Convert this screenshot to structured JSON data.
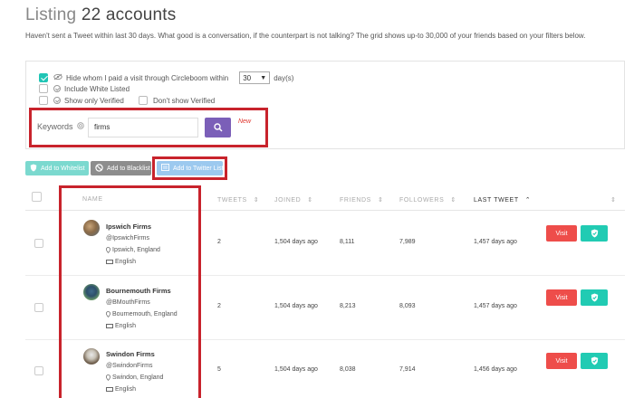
{
  "header": {
    "title_prefix": "Listing",
    "title_count": "22 accounts",
    "subtitle": "Haven't sent a Tweet within last 30 days. What good is a conversation, if the counterpart is not talking? The grid shows up-to 30,000 of your friends based on your filters below."
  },
  "filters": {
    "hide_visited_label": "Hide whom I paid a visit through Circleboom within",
    "days_value": "30",
    "days_unit": "day(s)",
    "include_white_listed_label": "Include White Listed",
    "only_verified_label": "Show only Verified",
    "dont_show_verified_label": "Don't show Verified",
    "hide_visited_checked": true
  },
  "search": {
    "label": "Keywords",
    "value": "firms",
    "new_badge": "New"
  },
  "actions": {
    "whitelist": "Add to Whitelist",
    "blacklist": "Add to Blacklist",
    "twitter_list": "Add to Twitter List"
  },
  "table": {
    "columns": [
      "NAME",
      "TWEETS",
      "JOINED",
      "FRIENDS",
      "FOLLOWERS",
      "LAST TWEET"
    ],
    "visit_label": "Visit",
    "rows": [
      {
        "name": "Ipswich Firms",
        "handle": "@IpswichFirms",
        "location": "Ipswich, England",
        "language": "English",
        "tweets": "2",
        "joined": "1,504 days ago",
        "friends": "8,111",
        "followers": "7,989",
        "last_tweet": "1,457 days ago"
      },
      {
        "name": "Bournemouth Firms",
        "handle": "@BMouthFirms",
        "location": "Bournemouth, England",
        "language": "English",
        "tweets": "2",
        "joined": "1,504 days ago",
        "friends": "8,213",
        "followers": "8,093",
        "last_tweet": "1,457 days ago"
      },
      {
        "name": "Swindon Firms",
        "handle": "@SwindonFirms",
        "location": "Swindon, England",
        "language": "English",
        "tweets": "5",
        "joined": "1,504 days ago",
        "friends": "8,038",
        "followers": "7,914",
        "last_tweet": "1,456 days ago"
      }
    ]
  },
  "colors": {
    "accent_teal": "#20c5b5",
    "search_button": "#7b5fb8",
    "visit_red": "#ee4d4a",
    "highlight_red": "#c8232c"
  }
}
